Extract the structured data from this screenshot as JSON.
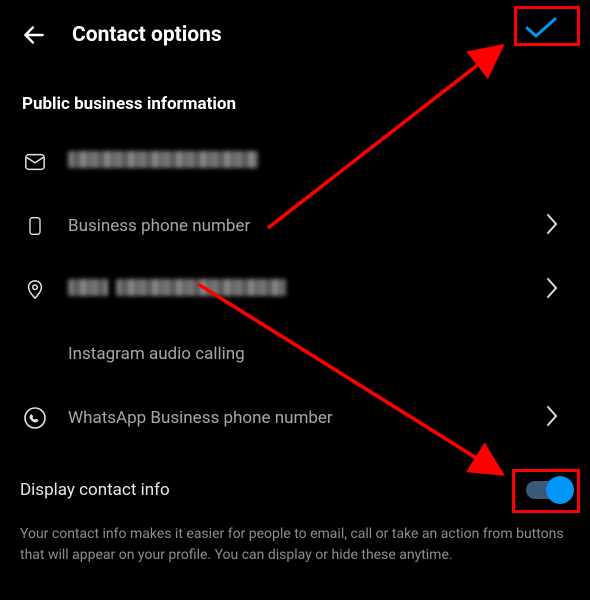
{
  "header": {
    "title": "Contact options"
  },
  "section_title": "Public business information",
  "rows": {
    "email": {
      "value": ""
    },
    "phone": {
      "label": "Business phone number"
    },
    "address": {
      "value": ""
    },
    "audio": {
      "label": "Instagram audio calling"
    },
    "whatsapp": {
      "label": "WhatsApp Business phone number"
    }
  },
  "toggle": {
    "label": "Display contact info",
    "on": true
  },
  "description": "Your contact info makes it easier for people to email, call or take an action from buttons that will appear on your profile. You can display or hide these anytime.",
  "colors": {
    "accent": "#0095f6",
    "annotation": "#ff0000"
  }
}
